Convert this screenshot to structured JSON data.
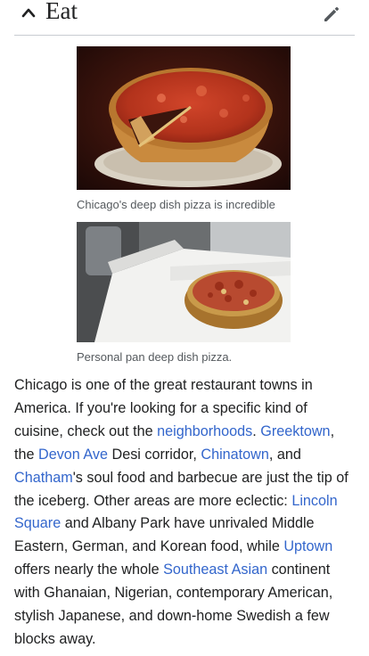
{
  "section": {
    "title": "Eat",
    "collapse_icon": "chevron-up-icon",
    "edit_icon": "pencil-icon"
  },
  "figures": [
    {
      "caption": "Chicago's deep dish pizza is incredible"
    },
    {
      "caption": "Personal pan deep dish pizza."
    }
  ],
  "article": {
    "t1": "Chicago is one of the great restaurant towns in America. If you're looking for a specific kind of cuisine, check out the ",
    "link_neighborhoods": "neighborhoods",
    "t2": ". ",
    "link_greektown": "Greektown",
    "t3": ", the ",
    "link_devon": "Devon Ave",
    "t4": " Desi corridor, ",
    "link_chinatown": "Chinatown",
    "t5": ", and ",
    "link_chatham": "Chatham",
    "t6": "'s soul food and barbecue are just the tip of the iceberg. Other areas are more eclectic: ",
    "link_lincoln_square": "Lincoln Square",
    "t7": " and Albany Park have unrivaled Middle Eastern, German, and Korean food, while ",
    "link_uptown": "Uptown",
    "t8": " offers nearly the whole ",
    "link_southeast_asian": "Southeast Asian",
    "t9": " continent with Ghanaian, Nigerian, contemporary American, stylish Japanese, and down-home Swedish a few blocks away."
  },
  "colors": {
    "link": "#3366cc",
    "text": "#202122",
    "caption": "#54595d"
  }
}
